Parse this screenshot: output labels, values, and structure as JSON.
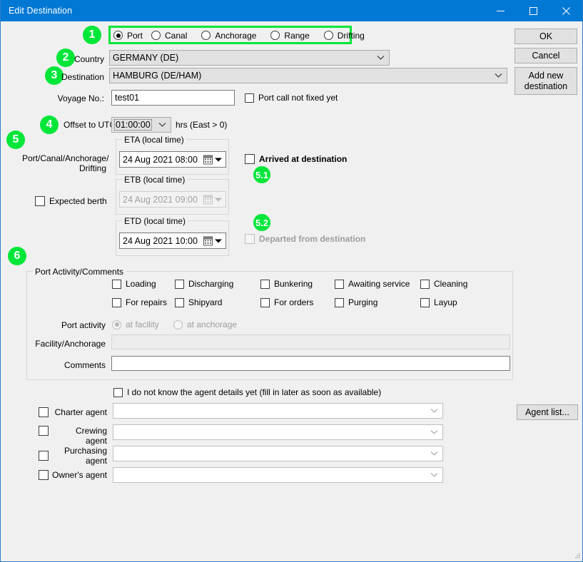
{
  "window": {
    "title": "Edit Destination",
    "titlebar_color": "#0078d4",
    "accent_green": "#00e639",
    "buttons": {
      "minimize": "minimize-icon",
      "maximize": "maximize-icon",
      "close": "close-icon"
    }
  },
  "annotations": {
    "b1": "1",
    "b2": "2",
    "b3": "3",
    "b4": "4",
    "b5": "5",
    "b51": "5.1",
    "b52": "5.2",
    "b6": "6"
  },
  "destination_type": {
    "options": [
      "Port",
      "Canal",
      "Anchorage",
      "Range",
      "Drifting"
    ],
    "selected": "Port"
  },
  "fields": {
    "country_label": "Country",
    "country_value": "GERMANY (DE)",
    "destination_label": "Destination",
    "destination_value": "HAMBURG (DE/HAM)",
    "voyage_label": "Voyage No.:",
    "voyage_value": "test01",
    "voyage_placeholder": "",
    "port_call_not_fixed_label": "Port call not fixed yet",
    "offset_label": "Offset to UTC",
    "offset_value": "01:00:00",
    "offset_suffix": "hrs (East > 0)"
  },
  "schedule": {
    "section_label": "Port/Canal/Anchorage/ Drifting",
    "section_label_line1": "Port/Canal/Anchorage/",
    "section_label_line2": "Drifting",
    "expected_berth_label": "Expected berth",
    "eta": {
      "caption": "ETA (local time)",
      "value": "24 Aug 2021 08:00"
    },
    "etb": {
      "caption": "ETB (local time)",
      "value": "24 Aug 2021 09:00"
    },
    "etd": {
      "caption": "ETD (local time)",
      "value": "24 Aug 2021 10:00"
    },
    "arrived_label": "Arrived at destination",
    "departed_label": "Departed from destination"
  },
  "port_activity": {
    "group_caption": "Port Activity/Comments",
    "checkboxes_row1": [
      "Loading",
      "Discharging",
      "Bunkering",
      "Awaiting service",
      "Cleaning"
    ],
    "checkboxes_row2": [
      "For repairs",
      "Shipyard",
      "For orders",
      "Purging",
      "Layup"
    ],
    "activity_label": "Port activity",
    "radio_facility": "at facility",
    "radio_anchorage": "at anchorage",
    "facility_label": "Facility/Anchorage",
    "facility_value": "",
    "comments_label": "Comments",
    "comments_value": ""
  },
  "agents": {
    "unknown_agent_label": "I do not know the agent details yet (fill in later as soon as available)",
    "rows": [
      {
        "label": "Charter agent",
        "value": ""
      },
      {
        "label": "Crewing agent",
        "value": ""
      },
      {
        "label": "Purchasing agent",
        "label_line1": "Purchasing",
        "label_line2": "agent",
        "value": ""
      },
      {
        "label": "Owner's agent",
        "value": ""
      }
    ],
    "agent_list_button": "Agent list..."
  },
  "dialog_buttons": {
    "ok": "OK",
    "cancel": "Cancel",
    "add_new_destination": "Add new destination",
    "add_new_destination_line1": "Add new",
    "add_new_destination_line2": "destination"
  }
}
